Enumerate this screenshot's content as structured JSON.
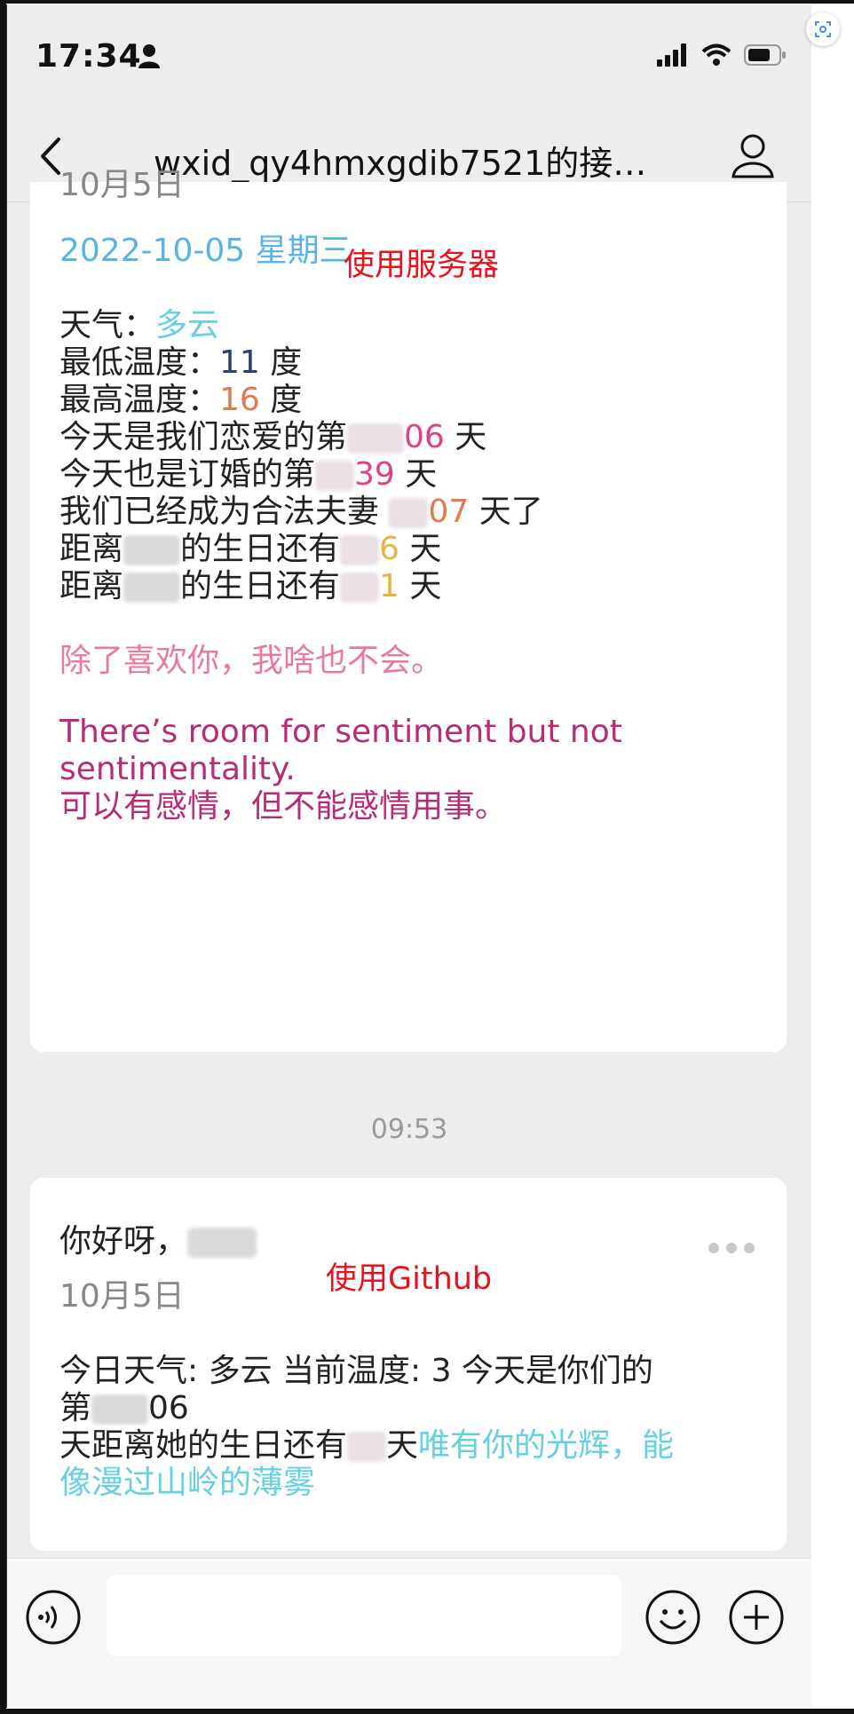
{
  "status_bar": {
    "time": "17:34"
  },
  "nav": {
    "title": "wxid_qy4hmxgdib7521的接…"
  },
  "card1": {
    "date": "10月5日",
    "date_full": "2022-10-05  星期三",
    "note": "使用服务器",
    "weather_label": "天气：",
    "weather_value": "多云",
    "min_temp_label": "最低温度：",
    "min_temp_value": "11",
    "max_temp_label": "最高温度：",
    "max_temp_value": "16",
    "unit_degree": "度",
    "love_prefix": "今天是我们恋爱的第",
    "love_value": "06",
    "engaged_prefix": "今天也是订婚的第",
    "engaged_value": "39",
    "married_prefix": "我们已经成为合法夫妻",
    "married_value": "07",
    "married_suffix": "天了",
    "bday1_prefix": "距离",
    "bday1_mid": "的生日还有",
    "bday1_value": "6",
    "bday2_prefix": "距离",
    "bday2_mid": "的生日还有",
    "bday2_value": "1",
    "unit_day": "天",
    "line_cn": "除了喜欢你，我啥也不会。",
    "quote_en_1": "There’s room for sentiment but not",
    "quote_en_2": "sentimentality.",
    "quote_cn": "可以有感情，但不能感情用事。"
  },
  "timestamp": "09:53",
  "card2": {
    "greeting": "你好呀，",
    "date": "10月5日",
    "note": "使用Github",
    "line1": "今日天气: 多云 当前温度: 3 今天是你们的",
    "line2_prefix": "第",
    "line2_value": "06",
    "line3_prefix": "天距离她的生日还有",
    "line3_suffix": "天",
    "line3_colored": "唯有你的光辉，能",
    "line4_colored": "像漫过山岭的薄雾"
  },
  "icons": {
    "back": "chevron-left-icon",
    "profile": "person-icon",
    "voice": "voice-icon",
    "emoji": "emoji-icon",
    "plus": "plus-icon"
  }
}
